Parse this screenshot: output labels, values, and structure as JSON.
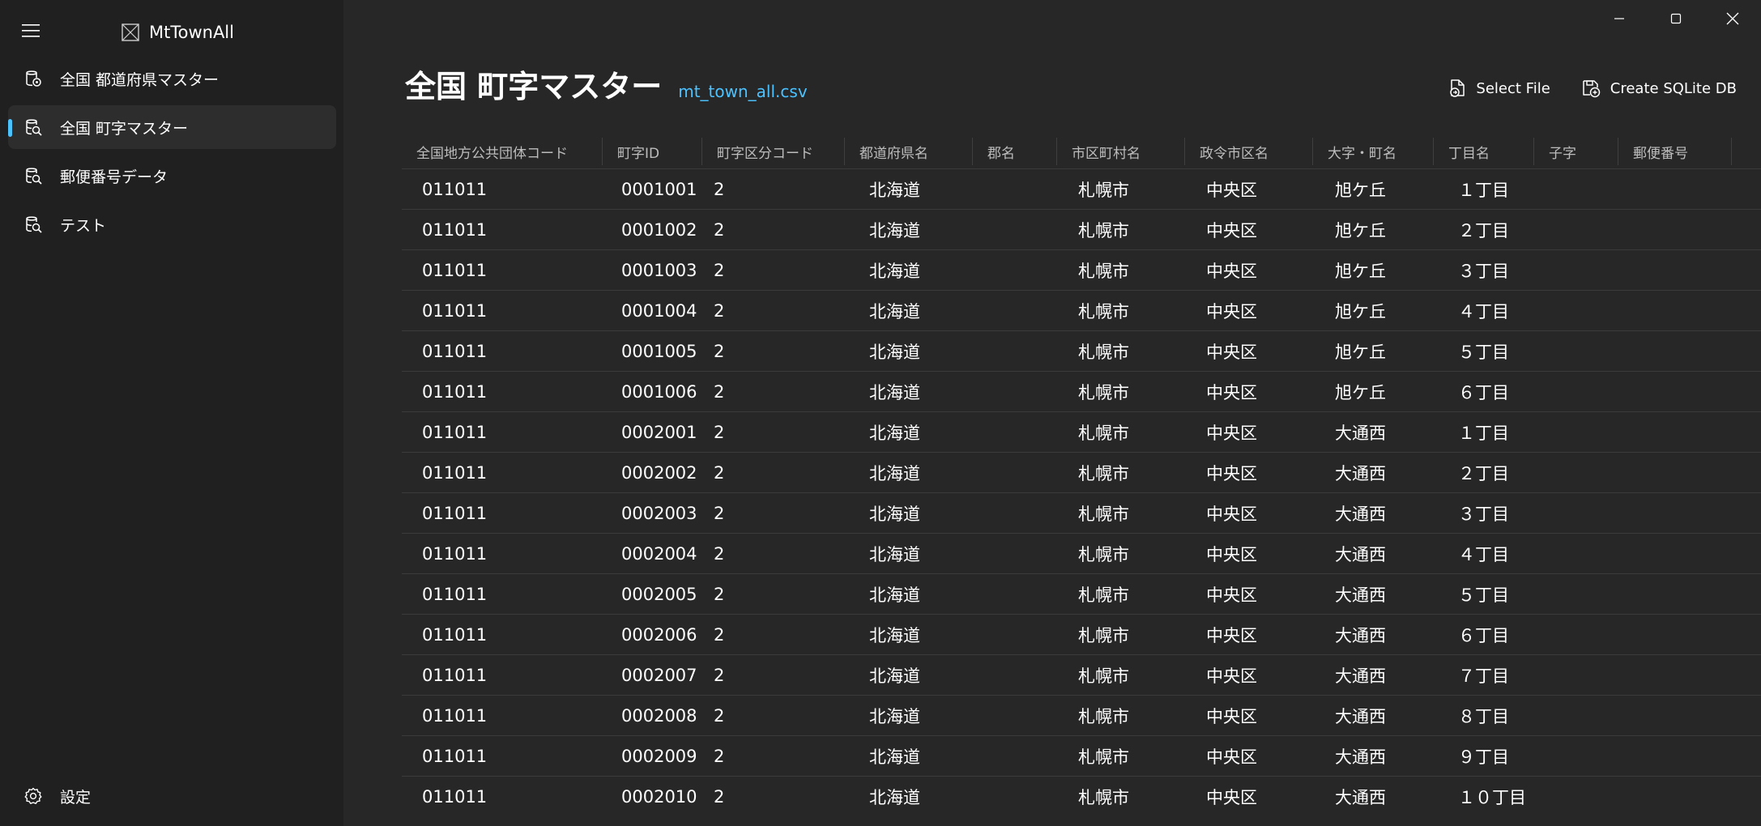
{
  "app": {
    "title": "MtTownAll"
  },
  "sidebar": {
    "items": [
      {
        "label": "全国 都道府県マスター",
        "icon": "database-settings-icon",
        "selected": false
      },
      {
        "label": "全国 町字マスター",
        "icon": "database-search-icon",
        "selected": true
      },
      {
        "label": "郵便番号データ",
        "icon": "database-search-icon",
        "selected": false
      },
      {
        "label": "テスト",
        "icon": "database-search-icon",
        "selected": false
      }
    ],
    "settings_label": "設定"
  },
  "header": {
    "title": "全国 町字マスター",
    "file_name": "mt_town_all.csv"
  },
  "toolbar": {
    "select_file_label": "Select File",
    "create_db_label": "Create SQLite DB"
  },
  "colors": {
    "accent": "#4cc2ff",
    "background": "#272727",
    "sidebar": "#202020"
  },
  "table": {
    "columns": [
      "全国地方公共団体コード",
      "町字ID",
      "町字区分コード",
      "都道府県名",
      "郡名",
      "市区町村名",
      "政令市区名",
      "大字・町名",
      "丁目名",
      "子字",
      "郵便番号"
    ],
    "rows": [
      [
        "011011",
        "0001001",
        "2",
        "北海道",
        "",
        "札幌市",
        "中央区",
        "旭ケ丘",
        "１丁目",
        "",
        ""
      ],
      [
        "011011",
        "0001002",
        "2",
        "北海道",
        "",
        "札幌市",
        "中央区",
        "旭ケ丘",
        "２丁目",
        "",
        ""
      ],
      [
        "011011",
        "0001003",
        "2",
        "北海道",
        "",
        "札幌市",
        "中央区",
        "旭ケ丘",
        "３丁目",
        "",
        ""
      ],
      [
        "011011",
        "0001004",
        "2",
        "北海道",
        "",
        "札幌市",
        "中央区",
        "旭ケ丘",
        "４丁目",
        "",
        ""
      ],
      [
        "011011",
        "0001005",
        "2",
        "北海道",
        "",
        "札幌市",
        "中央区",
        "旭ケ丘",
        "５丁目",
        "",
        ""
      ],
      [
        "011011",
        "0001006",
        "2",
        "北海道",
        "",
        "札幌市",
        "中央区",
        "旭ケ丘",
        "６丁目",
        "",
        ""
      ],
      [
        "011011",
        "0002001",
        "2",
        "北海道",
        "",
        "札幌市",
        "中央区",
        "大通西",
        "１丁目",
        "",
        ""
      ],
      [
        "011011",
        "0002002",
        "2",
        "北海道",
        "",
        "札幌市",
        "中央区",
        "大通西",
        "２丁目",
        "",
        ""
      ],
      [
        "011011",
        "0002003",
        "2",
        "北海道",
        "",
        "札幌市",
        "中央区",
        "大通西",
        "３丁目",
        "",
        ""
      ],
      [
        "011011",
        "0002004",
        "2",
        "北海道",
        "",
        "札幌市",
        "中央区",
        "大通西",
        "４丁目",
        "",
        ""
      ],
      [
        "011011",
        "0002005",
        "2",
        "北海道",
        "",
        "札幌市",
        "中央区",
        "大通西",
        "５丁目",
        "",
        ""
      ],
      [
        "011011",
        "0002006",
        "2",
        "北海道",
        "",
        "札幌市",
        "中央区",
        "大通西",
        "６丁目",
        "",
        ""
      ],
      [
        "011011",
        "0002007",
        "2",
        "北海道",
        "",
        "札幌市",
        "中央区",
        "大通西",
        "７丁目",
        "",
        ""
      ],
      [
        "011011",
        "0002008",
        "2",
        "北海道",
        "",
        "札幌市",
        "中央区",
        "大通西",
        "８丁目",
        "",
        ""
      ],
      [
        "011011",
        "0002009",
        "2",
        "北海道",
        "",
        "札幌市",
        "中央区",
        "大通西",
        "９丁目",
        "",
        ""
      ],
      [
        "011011",
        "0002010",
        "2",
        "北海道",
        "",
        "札幌市",
        "中央区",
        "大通西",
        "１０丁目",
        "",
        ""
      ]
    ]
  }
}
